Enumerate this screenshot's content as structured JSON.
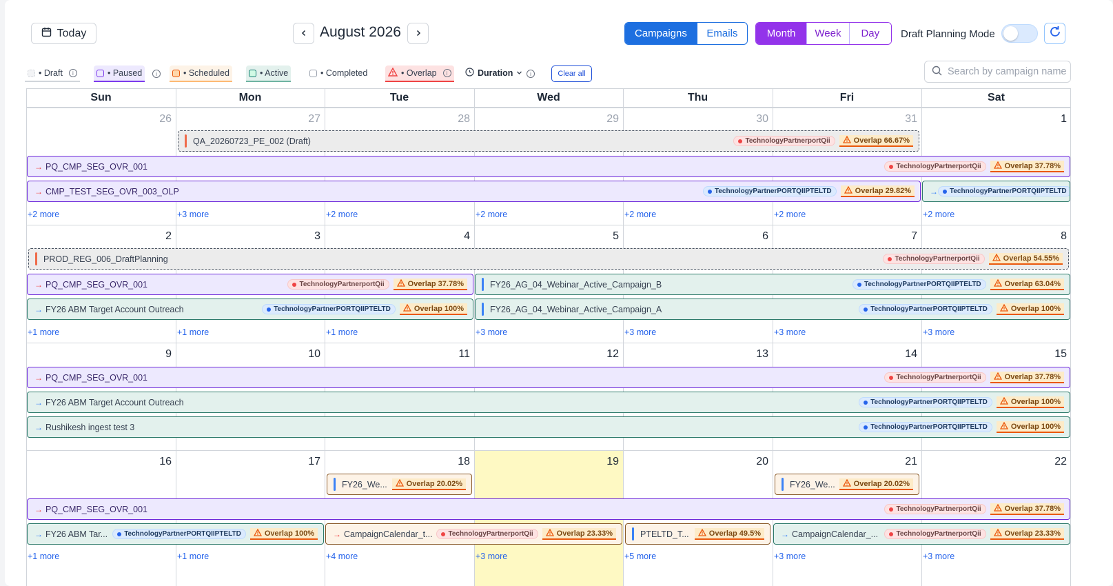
{
  "header": {
    "today_label": "Today",
    "month_title": "August 2026",
    "type_tabs": [
      "Campaigns",
      "Emails"
    ],
    "view_tabs": [
      "Month",
      "Week",
      "Day"
    ],
    "draft_mode_label": "Draft Planning Mode",
    "draft_mode_on": false
  },
  "filters": {
    "legend": [
      "• Draft",
      "• Paused",
      "• Scheduled",
      "• Active",
      "• Completed",
      "• Overlap"
    ],
    "duration_label": "Duration",
    "clear_label": "Clear all",
    "search_placeholder": "Search by campaign name"
  },
  "colors": {
    "primary": "#1d6fe0",
    "view_accent": "#9333ea",
    "draft": "#ececec",
    "paused": "#ede9fe",
    "scheduled": "#fdf3e7",
    "active": "#e3f1ed",
    "overlap": "#ef4444",
    "today_highlight": "#fef9c3"
  },
  "calendar": {
    "weekdays": [
      "Sun",
      "Mon",
      "Tue",
      "Wed",
      "Thu",
      "Fri",
      "Sat"
    ],
    "weeks": [
      {
        "days": [
          "26",
          "27",
          "28",
          "29",
          "30",
          "31",
          "1"
        ],
        "muted": [
          true,
          true,
          true,
          true,
          true,
          true,
          false
        ],
        "more": [
          "+2 more",
          "+3 more",
          "+2 more",
          "+2 more",
          "+2 more",
          "+2 more",
          "+2 more"
        ]
      },
      {
        "days": [
          "2",
          "3",
          "4",
          "5",
          "6",
          "7",
          "8"
        ],
        "muted": [
          false,
          false,
          false,
          false,
          false,
          false,
          false
        ],
        "more": [
          "+1 more",
          "+1 more",
          "+1 more",
          "+3 more",
          "+3 more",
          "+3 more",
          "+3 more"
        ]
      },
      {
        "days": [
          "9",
          "10",
          "11",
          "12",
          "13",
          "14",
          "15"
        ],
        "muted": [
          false,
          false,
          false,
          false,
          false,
          false,
          false
        ],
        "more": [
          "",
          "",
          "",
          "",
          "",
          "",
          ""
        ]
      },
      {
        "days": [
          "16",
          "17",
          "18",
          "19",
          "20",
          "21",
          "22"
        ],
        "muted": [
          false,
          false,
          false,
          false,
          false,
          false,
          false
        ],
        "more": [
          "+1 more",
          "+1 more",
          "+4 more",
          "+3 more",
          "+5 more",
          "+3 more",
          "+3 more"
        ]
      }
    ],
    "today": "19",
    "events": [
      {
        "name": "QA_20260723_PE_002 (Draft)",
        "status": "draft",
        "start_day": "27",
        "end_day": "31",
        "owner": "TechnologyPartnerportQii",
        "owner_color": "red",
        "overlap": "Overlap 66.67%"
      },
      {
        "name": "PQ_CMP_SEG_OVR_001",
        "status": "paused",
        "start_day": "26",
        "end_day": "1",
        "owner": "TechnologyPartnerportQii",
        "owner_color": "red",
        "overlap": "Overlap 37.78%"
      },
      {
        "name": "CMP_TEST_SEG_OVR_003_OLP",
        "status": "paused",
        "start_day": "26",
        "end_day": "31",
        "owner": "TechnologyPartnerPORTQIIPTELTD",
        "owner_color": "blue",
        "overlap": "Overlap 29.82%"
      },
      {
        "name": "",
        "status": "active",
        "start_day": "1",
        "end_day": "1",
        "owner": "TechnologyPartnerPORTQIIPTELTD",
        "owner_color": "blue",
        "overlap": ""
      },
      {
        "name": "PROD_REG_006_DraftPlanning",
        "status": "draft",
        "start_day": "2",
        "end_day": "8",
        "owner": "TechnologyPartnerportQii",
        "owner_color": "red",
        "overlap": "Overlap 54.55%"
      },
      {
        "name": "PQ_CMP_SEG_OVR_001",
        "status": "paused",
        "start_day": "2",
        "end_day": "4",
        "owner": "TechnologyPartnerportQii",
        "owner_color": "red",
        "overlap": "Overlap 37.78%"
      },
      {
        "name": "FY26_AG_04_Webinar_Active_Campaign_B",
        "status": "active",
        "start_day": "5",
        "end_day": "8",
        "owner": "TechnologyPartnerPORTQIIPTELTD",
        "owner_color": "blue",
        "overlap": "Overlap 63.04%"
      },
      {
        "name": "FY26 ABM Target Account Outreach",
        "status": "active",
        "start_day": "2",
        "end_day": "4",
        "owner": "TechnologyPartnerPORTQIIPTELTD",
        "owner_color": "blue",
        "overlap": "Overlap 100%"
      },
      {
        "name": "FY26_AG_04_Webinar_Active_Campaign_A",
        "status": "active",
        "start_day": "5",
        "end_day": "8",
        "owner": "TechnologyPartnerPORTQIIPTELTD",
        "owner_color": "blue",
        "overlap": "Overlap 100%"
      },
      {
        "name": "PQ_CMP_SEG_OVR_001",
        "status": "paused",
        "start_day": "9",
        "end_day": "15",
        "owner": "TechnologyPartnerportQii",
        "owner_color": "red",
        "overlap": "Overlap 37.78%"
      },
      {
        "name": "FY26 ABM Target Account Outreach",
        "status": "active",
        "start_day": "9",
        "end_day": "15",
        "owner": "TechnologyPartnerPORTQIIPTELTD",
        "owner_color": "blue",
        "overlap": "Overlap 100%"
      },
      {
        "name": "Rushikesh ingest test 3",
        "status": "active",
        "start_day": "9",
        "end_day": "15",
        "owner": "TechnologyPartnerPORTQIIPTELTD",
        "owner_color": "blue",
        "overlap": "Overlap 100%"
      },
      {
        "name": "FY26_We...",
        "status": "scheduled",
        "start_day": "18",
        "end_day": "18",
        "owner": "",
        "owner_color": "",
        "overlap": "Overlap 20.02%"
      },
      {
        "name": "FY26_We...",
        "status": "scheduled",
        "start_day": "21",
        "end_day": "21",
        "owner": "",
        "owner_color": "",
        "overlap": "Overlap 20.02%"
      },
      {
        "name": "PQ_CMP_SEG_OVR_001",
        "status": "paused",
        "start_day": "16",
        "end_day": "22",
        "owner": "TechnologyPartnerportQii",
        "owner_color": "red",
        "overlap": "Overlap 37.78%"
      },
      {
        "name": "FY26 ABM Tar...",
        "status": "active",
        "start_day": "16",
        "end_day": "17",
        "owner": "TechnologyPartnerPORTQIIPTELTD",
        "owner_color": "blue",
        "overlap": "Overlap 100%"
      },
      {
        "name": "CampaignCalendar_t...",
        "status": "scheduled",
        "start_day": "18",
        "end_day": "19",
        "owner": "TechnologyPartnerportQii",
        "owner_color": "red",
        "overlap": "Overlap 23.33%"
      },
      {
        "name": "PTELTD_T...",
        "status": "scheduled",
        "start_day": "20",
        "end_day": "20",
        "owner": "",
        "owner_color": "",
        "overlap": "Overlap 49.5%"
      },
      {
        "name": "CampaignCalendar_...",
        "status": "active",
        "start_day": "21",
        "end_day": "22",
        "owner": "TechnologyPartnerportQii",
        "owner_color": "red",
        "overlap": "Overlap 23.33%"
      }
    ]
  }
}
